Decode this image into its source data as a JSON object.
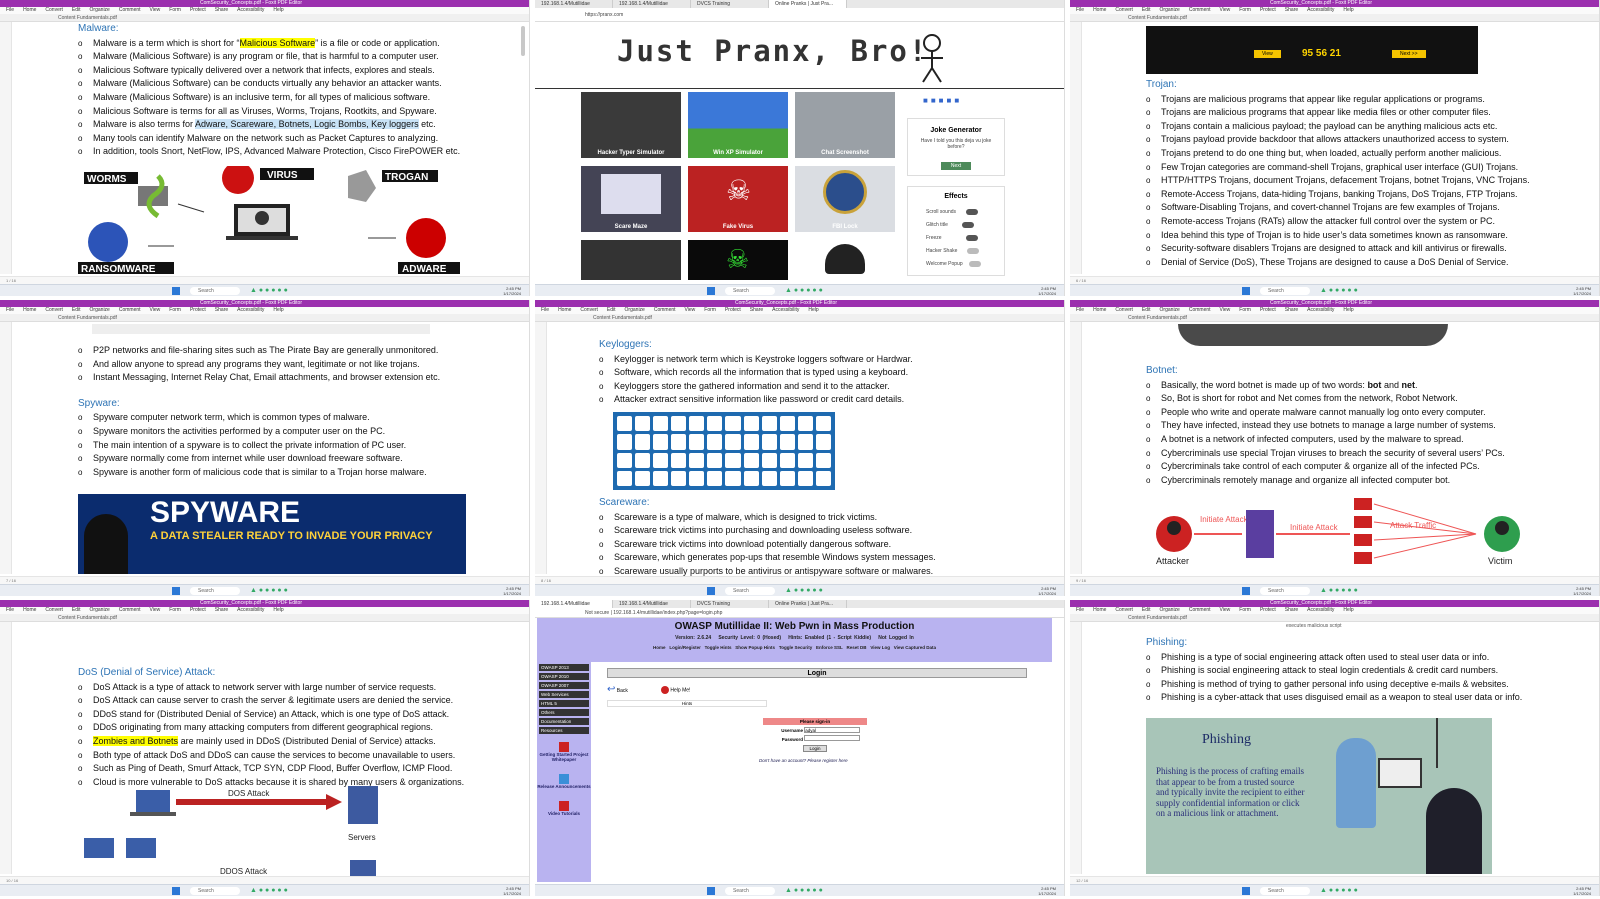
{
  "common": {
    "window_title": "ComSecurity_Concepts.pdf - Foxit PDF Editor",
    "menu_items": [
      "File",
      "Home",
      "Convert",
      "Edit",
      "Organize",
      "Comment",
      "View",
      "Form",
      "Protect",
      "Share",
      "Accessibility",
      "Help"
    ],
    "doc_tab": "Content Fundamentals.pdf",
    "taskbar_search": "Search",
    "clock_time": "2:45 PM",
    "clock_date": "1/17/2024"
  },
  "p1": {
    "heading": "Malware:",
    "items": [
      [
        "Malware is a term which is short for “",
        "Malicious Software",
        "” is a file or code or application."
      ],
      "Malware (Malicious Software) is any program or file, that is harmful to a computer user.",
      "Malicious Software typically delivered over a network that infects, explores and steals.",
      "Malware (Malicious Software) can be conducts virtually any behavior an attacker wants.",
      "Malware (Malicious Software) is an inclusive term, for all types of malicious software.",
      "Malicious Software is terms for all as Viruses, Worms, Trojans, Rootkits, and Spyware.",
      [
        "Malware is also terms for ",
        "Adware, Scareware, Botnets, Logic Bombs, Key loggers",
        " etc."
      ],
      "Many tools can identify Malware on the network such as Packet Captures to analyzing.",
      "In addition, tools Snort, NetFlow, IPS, Advanced Malware Protection, Cisco FirePOWER etc."
    ],
    "labels": {
      "worms": "WORMS",
      "virus": "VIRUS",
      "trogan": "TROGAN",
      "ransomware": "RANSOMWARE",
      "adware": "ADWARE"
    }
  },
  "p2": {
    "tabs": [
      "192.168.1.4/Mutillidae",
      "192.168.1.4/Mutillidae",
      "DVCS Training",
      "Online Pranks | Just Pra..."
    ],
    "url": "https://pranx.com",
    "site_title": "Just Pranx, Bro!",
    "tiles": [
      "Hacker Typer Simulator",
      "Win XP Simulator",
      "Chat Screenshot",
      "Scare Maze",
      "Fake Virus",
      "FBI Lock"
    ],
    "joke_title": "Joke Generator",
    "joke_text": "Have I told you this deja vu joke before?",
    "joke_button": "Next",
    "effects_title": "Effects",
    "effects": [
      "Scroll sounds",
      "Glitch title",
      "Freeze",
      "Hacker Shake",
      "Welcome Popup"
    ]
  },
  "p3": {
    "counter": "95 56 21",
    "btn_view": "View",
    "btn_next": "Next >>",
    "heading": "Trojan:",
    "items": [
      "Trojans are malicious programs that appear like regular applications or programs.",
      "Trojans are malicious programs that appear like media files or other computer files.",
      "Trojans contain a malicious payload; the payload can be anything malicious acts etc.",
      "Trojans payload provide backdoor that allows attackers unauthorized access to system.",
      "Trojans pretend to do one thing but, when loaded, actually perform another malicious.",
      "Few Trojan categories are command-shell Trojans, graphical user interface (GUI) Trojans.",
      "HTTP/HTTPS Trojans, document Trojans, defacement Trojans, botnet Trojans, VNC Trojans.",
      "Remote-Access Trojans, data-hiding Trojans, banking Trojans, DoS Trojans, FTP Trojans.",
      "Software-Disabling Trojans, and covert-channel Trojans are few examples of Trojans.",
      "Remote-access Trojans (RATs) allow the attacker full control over the system or PC.",
      "Idea behind this type of Trojan is to hide user’s data sometimes known as ransomware.",
      "Security-software disablers Trojans are designed to attack and kill antivirus or firewalls.",
      "Denial of Service (DoS), These Trojans are designed to cause a DoS Denial of Service."
    ]
  },
  "p4": {
    "items_top": [
      "P2P networks and file-sharing sites such as The Pirate Bay are generally unmonitored.",
      "And allow anyone to spread any programs they want, legitimate or not like trojans.",
      "Instant Messaging, Internet Relay Chat, Email attachments, and browser extension etc."
    ],
    "heading": "Spyware:",
    "items": [
      "Spyware computer network term, which is common types of malware.",
      "Spyware monitors the activities performed by a computer user on the PC.",
      "The main intention of a spyware is to collect the private information of PC user.",
      "Spyware normally come from internet while user download freeware software.",
      "Spyware is another form of malicious code that is similar to a Trojan horse malware."
    ],
    "banner_title": "SPYWARE",
    "banner_sub": "A DATA STEALER READY TO INVADE YOUR PRIVACY"
  },
  "p5": {
    "heading": "Keyloggers:",
    "items": [
      "Keylogger is network term which is Keystroke loggers software or Hardwar.",
      "Software, which records all the information that is typed using a keyboard.",
      "Keyloggers store the gathered information and send it to the attacker.",
      "Attacker extract sensitive information like password or credit card details."
    ],
    "heading2": "Scareware:",
    "items2": [
      "Scareware is a type of malware, which is designed to trick victims.",
      "Scareware trick victims into purchasing and downloading useless software.",
      "Scareware trick victims into download potentially dangerous software.",
      "Scareware, which generates pop-ups that resemble Windows system messages.",
      "Scareware usually purports to be antivirus or antispyware software or malwares."
    ]
  },
  "p6": {
    "heading": "Botnet:",
    "items": [
      [
        "Basically, the word botnet is made up of two words: ",
        "bot",
        " and ",
        "net",
        "."
      ],
      "So, Bot is short for robot and Net comes from the network, Robot Network.",
      "People who write and operate malware cannot manually log onto every computer.",
      "They have infected, instead they use botnets to manage a large number of systems.",
      "A botnet is a network of infected computers, used by the malware to spread.",
      "Cybercriminals use special Trojan viruses to breach the security of several users’ PCs.",
      "Cybercriminals take control of each computer & organize all of the infected PCs.",
      "Cybercriminals remotely manage and organize all infected computer bot."
    ],
    "diagram": {
      "attacker": "Attacker",
      "victim": "Victim",
      "initiate1": "Initiate Attack",
      "initiate2": "Initiate Attack",
      "traffic": "Attack Traffic"
    }
  },
  "p7": {
    "heading": "DoS (Denial of Service) Attack:",
    "items": [
      "DoS Attack is a type of attack to network server with large number of service requests.",
      "DoS Attack can cause server to crash the server & legitimate users are denied the service.",
      "DDoS stand for (Distributed Denial of Service) an Attack, which is one type of DoS attack.",
      "DDoS originating from many attacking computers from different geographical regions.",
      [
        "",
        "Zombies and Botnets",
        " are mainly used in DDoS (Distributed Denial of Service) attacks."
      ],
      "Both type of attack DoS and DDoS can cause the services to become unavailable to users.",
      "Such as Ping of Death, Smurf Attack, TCP SYN, CDP Flood, Buffer Overflow, ICMP Flood.",
      "Cloud is more vulnerable to DoS attacks because it is shared by many users & organizations."
    ],
    "dos_label": "DOS Attack",
    "servers_label": "Servers",
    "ddos_label": "DDOS Attack"
  },
  "p8": {
    "tabs": [
      "192.168.1.4/Mutillidae",
      "192.168.1.4/Mutillidae",
      "DVCS Training",
      "Online Pranks | Just Pra..."
    ],
    "url": "Not secure | 192.168.1.4/mutillidae/index.php?page=login.php",
    "title": "OWASP Mutillidae II: Web Pwn in Mass Production",
    "meta": [
      "Version: 2.6.24",
      "Security Level: 0 (Hosed)",
      "Hints: Enabled (1 - Script Kiddie)",
      "Not Logged In"
    ],
    "nav": [
      "Home",
      "Login/Register",
      "Toggle Hints",
      "Show Popup Hints",
      "Toggle Security",
      "Enforce SSL",
      "Reset DB",
      "View Log",
      "View Captured Data"
    ],
    "side": [
      "OWASP 2013",
      "OWASP 2010",
      "OWASP 2007",
      "Web Services",
      "HTML 5",
      "Others",
      "Documentation",
      "Resources"
    ],
    "side_links": [
      "Getting Started Project Whitepaper",
      "Release Announcements",
      "Video Tutorials"
    ],
    "login_title": "Login",
    "back": "Back",
    "help": "Help Me!",
    "hints": "Hints",
    "signin": "Please sign-in",
    "username_label": "Username",
    "username_value": "adyal",
    "password_label": "Password",
    "login_btn": "Login",
    "register": "Don't have an account? Please register here"
  },
  "p9": {
    "top_text": "executes malicious script",
    "heading": "Phishing:",
    "items": [
      "Phishing is a type of social engineering attack often used to steal user data or info.",
      "Phishing is social engineering attack to steal login credentials & credit card numbers.",
      "Phishing is method of trying to gather personal info using deceptive e-mails & websites.",
      "Phishing is a cyber-attack that uses disguised email as a weapon to steal user data or info."
    ],
    "image_title": "Phishing",
    "image_text": "Phishing is the process of crafting emails that appear to be from a trusted source and typically invite the recipient to either supply confidential information or click on a malicious link or attachment."
  }
}
